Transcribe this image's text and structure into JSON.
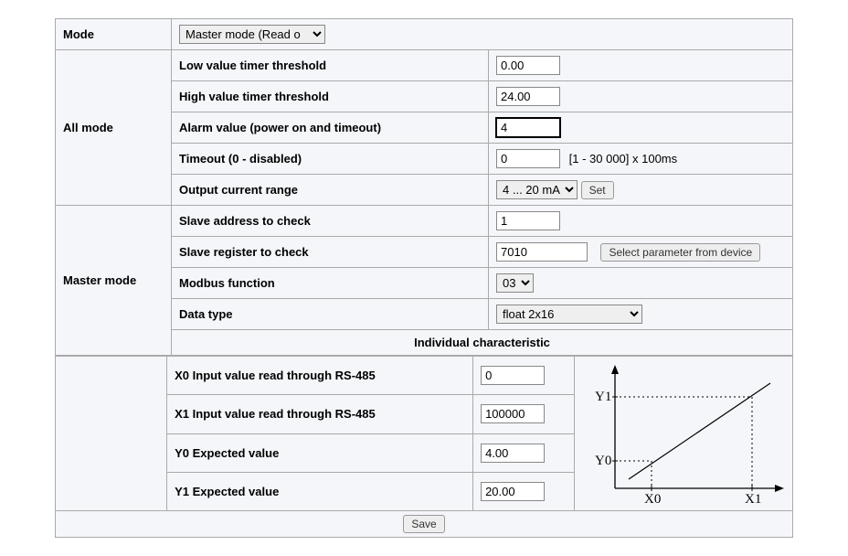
{
  "mode_row": {
    "label": "Mode",
    "select_value": "Master mode (Read o"
  },
  "all_mode": {
    "title": "All mode",
    "low_thresh_label": "Low value timer threshold",
    "low_thresh_value": "0.00",
    "high_thresh_label": "High value timer threshold",
    "high_thresh_value": "24.00",
    "alarm_label": "Alarm value (power on and timeout)",
    "alarm_value": "4",
    "timeout_label": "Timeout (0 - disabled)",
    "timeout_value": "0",
    "timeout_hint": "[1 - 30 000] x 100ms",
    "out_range_label": "Output current range",
    "out_range_value": "4 ... 20 mA",
    "set_btn": "Set"
  },
  "master_mode": {
    "title": "Master mode",
    "slave_addr_label": "Slave address to check",
    "slave_addr_value": "1",
    "slave_reg_label": "Slave register to check",
    "slave_reg_value": "7010",
    "select_param_btn": "Select parameter from device",
    "modbus_fn_label": "Modbus function",
    "modbus_fn_value": "03",
    "data_type_label": "Data type",
    "data_type_value": "float 2x16",
    "indiv_title": "Individual characteristic",
    "x0_label": "X0 Input value read through RS-485",
    "x0_value": "0",
    "x1_label": "X1 Input value read through RS-485",
    "x1_value": "100000",
    "y0_label": "Y0 Expected value",
    "y0_value": "4.00",
    "y1_label": "Y1 Expected value",
    "y1_value": "20.00"
  },
  "chart_data": {
    "type": "line",
    "axis_labels": {
      "x0": "X0",
      "x1": "X1",
      "y0": "Y0",
      "y1": "Y1"
    },
    "description": "Linear characteristic mapping X0..X1 to Y0..Y1, with diagonal line passing through (X0,Y0) and (X1,Y1), dotted guide lines at X0, X1 and Y0, Y1"
  },
  "save_btn": "Save"
}
